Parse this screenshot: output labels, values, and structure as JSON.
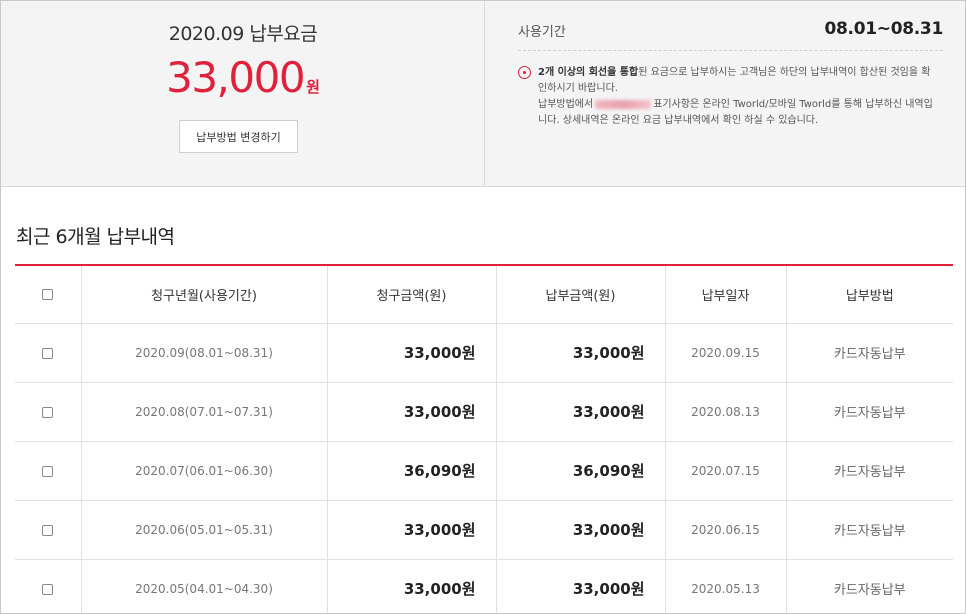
{
  "summary": {
    "bill_title": "2020.09 납부요금",
    "amount": "33,000",
    "amount_unit": "원",
    "change_button_label": "납부방법 변경하기",
    "period_label": "사용기간",
    "period_value": "08.01~08.31",
    "notice_bold": "2개 이상의 회선을 통합",
    "notice_line1": "된 요금으로 납부하시는 고객님은 하단의 납부내역이 합산된 것임을 확인하시기 바랍니다.",
    "notice_line2_a": "납부방법에서",
    "notice_line2_b": "표기사항은 온라인 Tworld/모바일 Tworld를 통해 납부하신 내역입니다. 상세내역은 온라인 요금 납부내역에서 확인 하실 수 있습니다.",
    "accent_color": "#e0213c"
  },
  "history": {
    "title": "최근 6개월 납부내역",
    "columns": [
      "청구년월(사용기간)",
      "청구금액(원)",
      "납부금액(원)",
      "납부일자",
      "납부방법"
    ],
    "rows": [
      {
        "month": "2020.09(08.01~08.31)",
        "billed": "33,000원",
        "paid": "33,000원",
        "date": "2020.09.15",
        "method": "카드자동납부"
      },
      {
        "month": "2020.08(07.01~07.31)",
        "billed": "33,000원",
        "paid": "33,000원",
        "date": "2020.08.13",
        "method": "카드자동납부"
      },
      {
        "month": "2020.07(06.01~06.30)",
        "billed": "36,090원",
        "paid": "36,090원",
        "date": "2020.07.15",
        "method": "카드자동납부"
      },
      {
        "month": "2020.06(05.01~05.31)",
        "billed": "33,000원",
        "paid": "33,000원",
        "date": "2020.06.15",
        "method": "카드자동납부"
      },
      {
        "month": "2020.05(04.01~04.30)",
        "billed": "33,000원",
        "paid": "33,000원",
        "date": "2020.05.13",
        "method": "카드자동납부"
      }
    ]
  }
}
